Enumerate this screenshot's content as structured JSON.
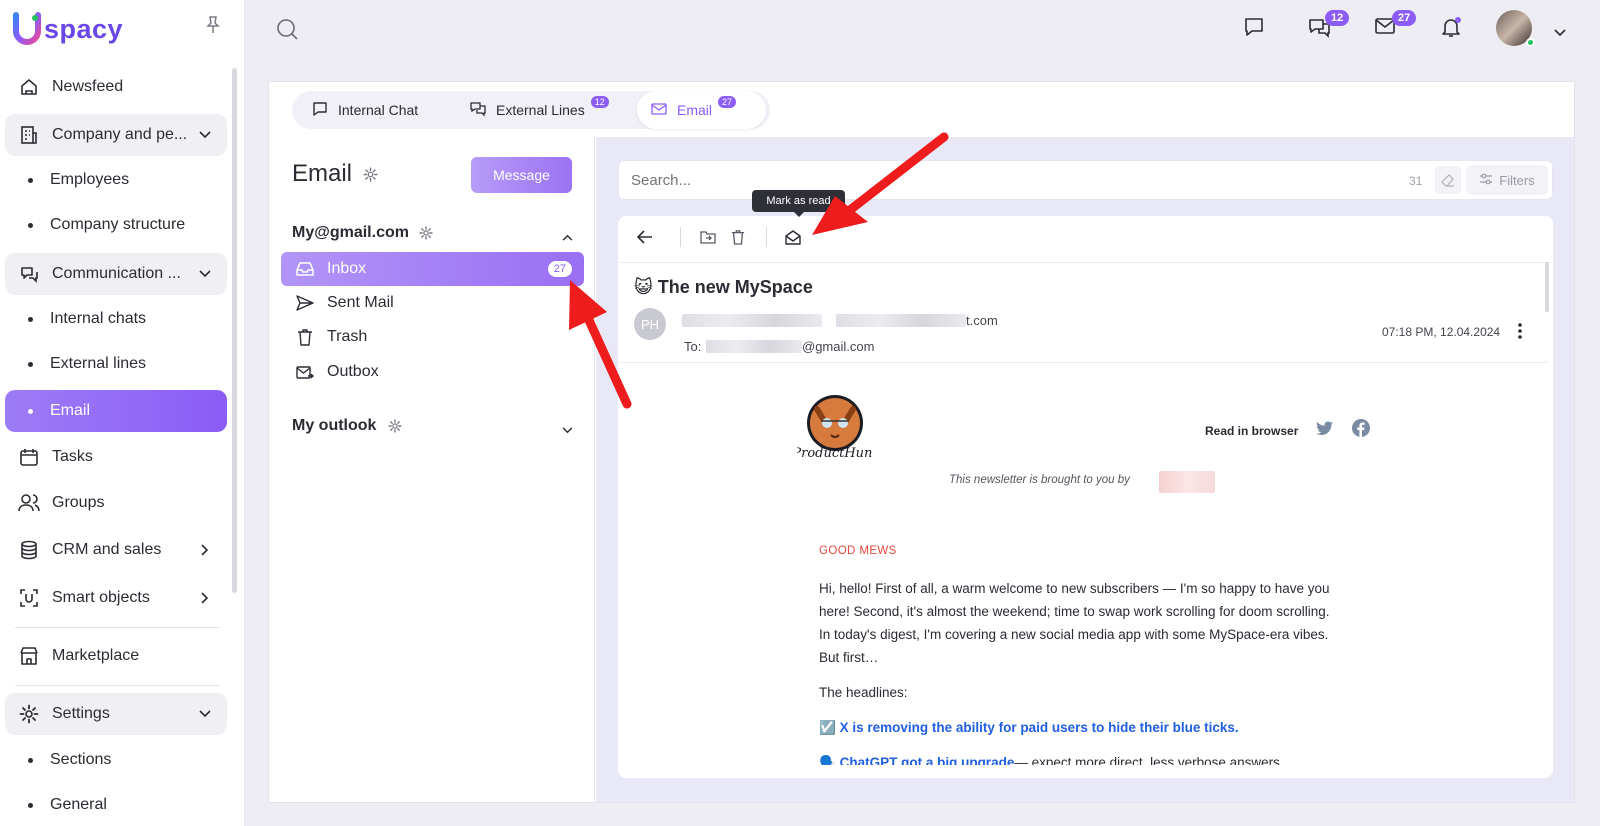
{
  "app": {
    "logo_text": "spacy",
    "logo_mark": "U"
  },
  "sidebar": {
    "items": [
      {
        "label": "Newsfeed",
        "icon": "home-icon"
      },
      {
        "label": "Company and pe...",
        "icon": "building-icon"
      },
      {
        "label": "Employees"
      },
      {
        "label": "Company structure"
      },
      {
        "label": "Communication ...",
        "icon": "communication-icon"
      },
      {
        "label": "Internal chats"
      },
      {
        "label": "External lines"
      },
      {
        "label": "Email"
      },
      {
        "label": "Tasks",
        "icon": "calendar-icon"
      },
      {
        "label": "Groups",
        "icon": "users-icon"
      },
      {
        "label": "CRM and sales",
        "icon": "database-icon"
      },
      {
        "label": "Smart objects",
        "icon": "smart-object-icon"
      },
      {
        "label": "Marketplace",
        "icon": "store-icon"
      },
      {
        "label": "Settings",
        "icon": "gear-icon"
      },
      {
        "label": "Sections"
      },
      {
        "label": "General"
      }
    ]
  },
  "header": {
    "chat_badge": "12",
    "mail_badge": "27"
  },
  "tabs": [
    {
      "label": "Internal Chat",
      "badge": ""
    },
    {
      "label": "External Lines",
      "badge": "12"
    },
    {
      "label": "Email",
      "badge": "27"
    }
  ],
  "email": {
    "title": "Email",
    "message_button": "Message",
    "account1": "My@gmail.com",
    "account2": "My outlook",
    "folders": [
      {
        "label": "Inbox",
        "count": "27"
      },
      {
        "label": "Sent Mail"
      },
      {
        "label": "Trash"
      },
      {
        "label": "Outbox"
      }
    ]
  },
  "search": {
    "placeholder": "Search...",
    "count": "31",
    "filters_label": "Filters"
  },
  "toolbar": {
    "tooltip": "Mark as read"
  },
  "message": {
    "emoji": "😺",
    "subject": "The new MySpace",
    "sender_initials": "PH",
    "sender_suffix": "t.com",
    "to_label": "To:",
    "to_suffix": "@gmail.com",
    "date": "07:18 PM, 12.04.2024",
    "read_in_browser": "Read in browser",
    "brought_by": "This newsletter is brought to you by",
    "good_mews": "GOOD MEWS",
    "para1": "Hi, hello! First of all, a warm welcome to new subscribers — I'm so happy to have you here! Second, it's almost the weekend; time to swap work scrolling for doom scrolling. In today's digest, I'm covering a new social media app with some MySpace-era vibes. But first…",
    "headlines": "The headlines:",
    "item1_emoji": "☑️",
    "item1_link": "X is removing the ability for paid users to hide their blue ticks.",
    "item2_emoji": "🗣️",
    "item2_link": "ChatGPT got a big upgrade",
    "item2_rest": "— expect more direct, less verbose answers."
  },
  "colors": {
    "accent": "#8b5cf6",
    "arrow": "#ee1c1c"
  }
}
